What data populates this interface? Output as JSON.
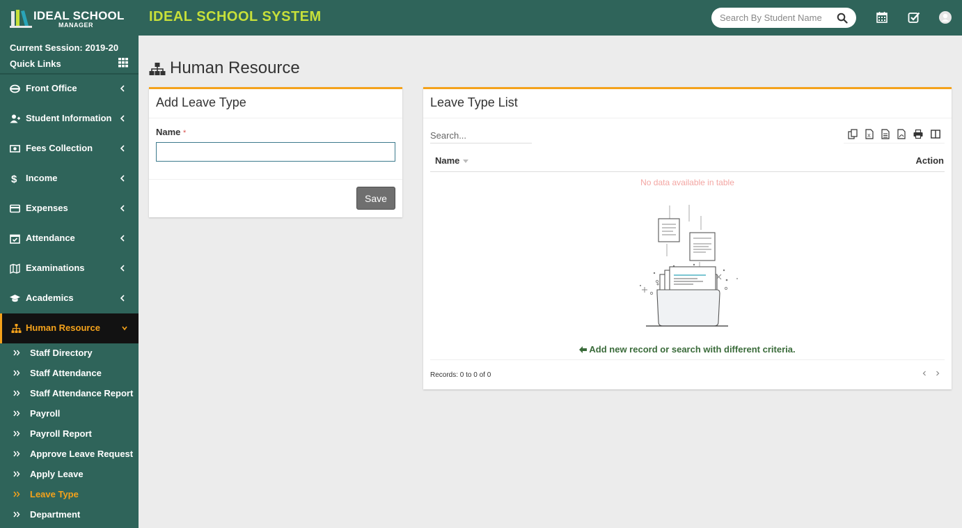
{
  "header": {
    "logo_title": "IDEAL SCHOOL",
    "logo_subtitle": "MANAGER",
    "app_title": "IDEAL SCHOOL SYSTEM",
    "search_placeholder": "Search By Student Name",
    "icons": [
      "calendar-icon",
      "tasks-icon",
      "user-avatar-icon"
    ]
  },
  "sidebar": {
    "session": "Current Session: 2019-20",
    "quick_links": "Quick Links",
    "items": [
      {
        "label": "Front Office",
        "icon": "front-office-icon"
      },
      {
        "label": "Student Information",
        "icon": "user-plus-icon"
      },
      {
        "label": "Fees Collection",
        "icon": "money-icon"
      },
      {
        "label": "Income",
        "icon": "dollar-icon"
      },
      {
        "label": "Expenses",
        "icon": "credit-card-icon"
      },
      {
        "label": "Attendance",
        "icon": "calendar-check-icon"
      },
      {
        "label": "Examinations",
        "icon": "map-icon"
      },
      {
        "label": "Academics",
        "icon": "graduation-cap-icon"
      },
      {
        "label": "Human Resource",
        "icon": "sitemap-icon",
        "active": true
      }
    ],
    "sub_items": [
      {
        "label": "Staff Directory"
      },
      {
        "label": "Staff Attendance"
      },
      {
        "label": "Staff Attendance Report"
      },
      {
        "label": "Payroll"
      },
      {
        "label": "Payroll Report"
      },
      {
        "label": "Approve Leave Request"
      },
      {
        "label": "Apply Leave"
      },
      {
        "label": "Leave Type",
        "active": true
      },
      {
        "label": "Department"
      }
    ]
  },
  "page": {
    "title": "Human Resource"
  },
  "add_form": {
    "title": "Add Leave Type",
    "name_label": "Name",
    "required_mark": "*",
    "name_value": "",
    "save_label": "Save"
  },
  "list": {
    "title": "Leave Type List",
    "search_placeholder": "Search...",
    "toolbar_icons": [
      "copy-icon",
      "excel-icon",
      "csv-icon",
      "pdf-icon",
      "print-icon",
      "columns-icon"
    ],
    "columns": [
      "Name",
      "Action"
    ],
    "rows": [],
    "no_data": "No data available in table",
    "hint": "Add new record or search with different criteria.",
    "records": "Records: 0 to 0 of 0"
  },
  "colors": {
    "primary": "#2f645a",
    "accent": "#f4a21b",
    "title_green": "#c7e03a",
    "active_bg": "#121212"
  }
}
